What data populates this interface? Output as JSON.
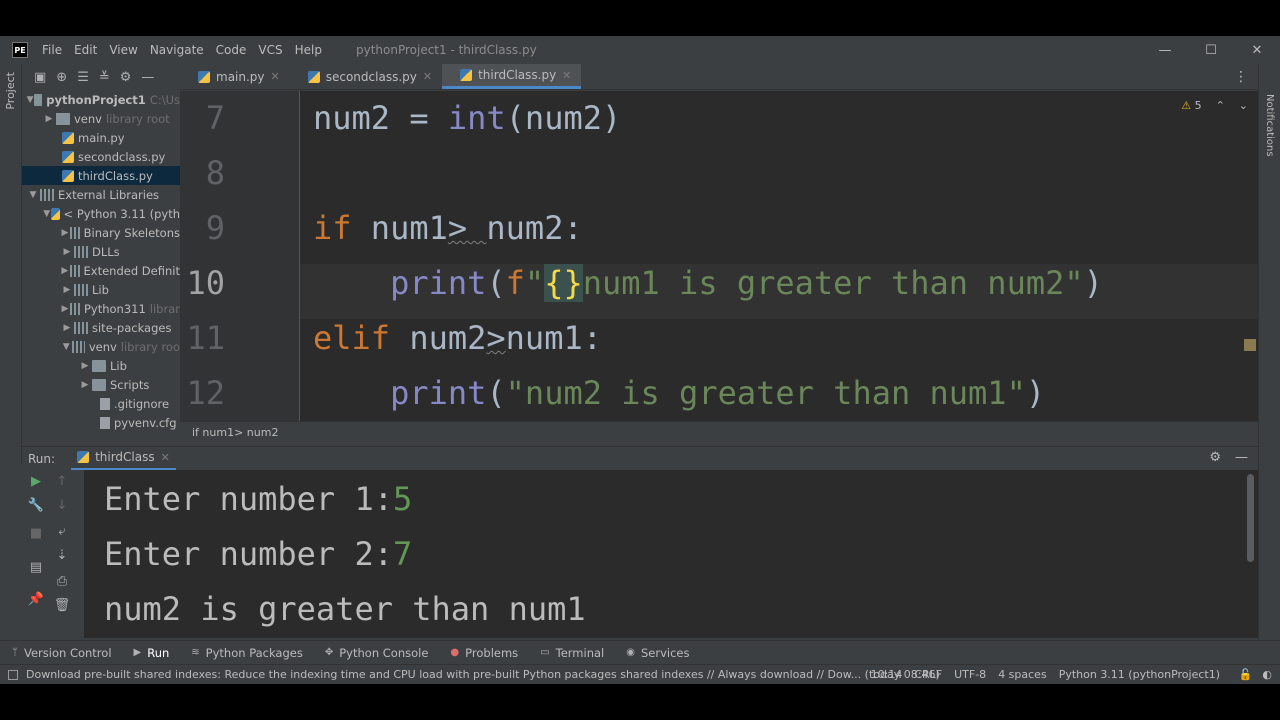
{
  "app": {
    "logo": "PE",
    "menu": [
      "File",
      "Edit",
      "View",
      "Navigate",
      "Code",
      "VCS",
      "Help"
    ],
    "title": "pythonProject1 - thirdClass.py",
    "window_controls": [
      "minimize-icon",
      "maximize-icon",
      "close-icon"
    ]
  },
  "left_stripe": {
    "label": "Project"
  },
  "right_stripe": {
    "label": "Notifications"
  },
  "project_tree": [
    {
      "label": "pythonProject1",
      "hint": "C:\\Us",
      "bold": true
    },
    {
      "label": "venv",
      "hint": "library root"
    },
    {
      "label": "main.py"
    },
    {
      "label": "secondclass.py"
    },
    {
      "label": "thirdClass.py",
      "selected": true
    },
    {
      "label": "External Libraries"
    },
    {
      "label": "< Python 3.11 (pyth"
    },
    {
      "label": "Binary Skeletons"
    },
    {
      "label": "DLLs"
    },
    {
      "label": "Extended Definit"
    },
    {
      "label": "Lib"
    },
    {
      "label": "Python311",
      "hint": "librar"
    },
    {
      "label": "site-packages"
    },
    {
      "label": "venv",
      "hint": "library roo"
    },
    {
      "label": "Lib"
    },
    {
      "label": "Scripts"
    },
    {
      "label": ".gitignore"
    },
    {
      "label": "pyvenv.cfg"
    }
  ],
  "tabs": [
    {
      "label": "main.py",
      "active": false
    },
    {
      "label": "secondclass.py",
      "active": false
    },
    {
      "label": "thirdClass.py",
      "active": true
    }
  ],
  "editor": {
    "warning_count": "5",
    "line_numbers": [
      "7",
      "8",
      "9",
      "10",
      "11",
      "12"
    ],
    "current_line": "10"
  },
  "breadcrumb": "if num1> num2",
  "run": {
    "label": "Run:",
    "tab": "thirdClass",
    "output": [
      {
        "prompt": "Enter number 1:",
        "input": "5"
      },
      {
        "prompt": "Enter number 2:",
        "input": "7"
      },
      {
        "prompt": "num2 is greater than num1",
        "input": ""
      }
    ]
  },
  "tool_windows": [
    {
      "label": "Version Control",
      "icon": "branch-icon"
    },
    {
      "label": "Run",
      "icon": "play-icon",
      "active": true
    },
    {
      "label": "Python Packages",
      "icon": "layers-icon"
    },
    {
      "label": "Python Console",
      "icon": "console-icon"
    },
    {
      "label": "Problems",
      "icon": "error-dot-icon"
    },
    {
      "label": "Terminal",
      "icon": "terminal-icon"
    },
    {
      "label": "Services",
      "icon": "services-icon"
    }
  ],
  "status": {
    "message": "Download pre-built shared indexes: Reduce the indexing time and CPU load with pre-built Python packages shared indexes // Always download // Dow... (today 08:46)",
    "position": "10:14",
    "line_sep": "CRLF",
    "encoding": "UTF-8",
    "indent": "4 spaces",
    "interpreter": "Python 3.11 (pythonProject1)"
  },
  "colors": {
    "keyword": "#cc7832",
    "builtin": "#8888c6",
    "string": "#6a8759",
    "accent": "#4a88c7",
    "console_input": "#629755"
  }
}
